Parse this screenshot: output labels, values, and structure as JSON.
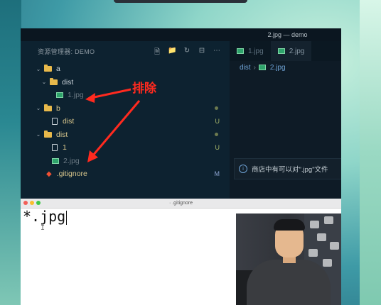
{
  "vscode": {
    "window_title": "2.jpg — demo",
    "explorer_title": "资源管理器: DEMO",
    "tree": [
      {
        "name": "a",
        "type": "folder",
        "depth": 0,
        "expanded": true,
        "badge": ""
      },
      {
        "name": "dist",
        "type": "folder",
        "depth": 1,
        "expanded": true,
        "badge": ""
      },
      {
        "name": "1.jpg",
        "type": "image",
        "depth": 2,
        "ignored": true,
        "badge": ""
      },
      {
        "name": "b",
        "type": "folder",
        "depth": 0,
        "expanded": true,
        "badge": "•"
      },
      {
        "name": "dist",
        "type": "file",
        "depth": 1,
        "badge": "U"
      },
      {
        "name": "dist",
        "type": "folder",
        "depth": 0,
        "expanded": true,
        "badge": "•"
      },
      {
        "name": "1",
        "type": "file",
        "depth": 1,
        "badge": "U"
      },
      {
        "name": "2.jpg",
        "type": "image",
        "depth": 1,
        "ignored": true,
        "badge": ""
      },
      {
        "name": ".gitignore",
        "type": "git",
        "depth": 0,
        "badge": "M"
      }
    ],
    "tabs": [
      {
        "label": "1.jpg",
        "active": false
      },
      {
        "label": "2.jpg",
        "active": true
      }
    ],
    "breadcrumb": [
      "dist",
      "2.jpg"
    ],
    "notice": "商店中有可以对\".jpg\"文件"
  },
  "annotation": {
    "text": "排除",
    "color": "#ff2a1f"
  },
  "editor": {
    "window_title": "· .gitignore",
    "content": "*.jpg",
    "cursor_hint": "I"
  }
}
